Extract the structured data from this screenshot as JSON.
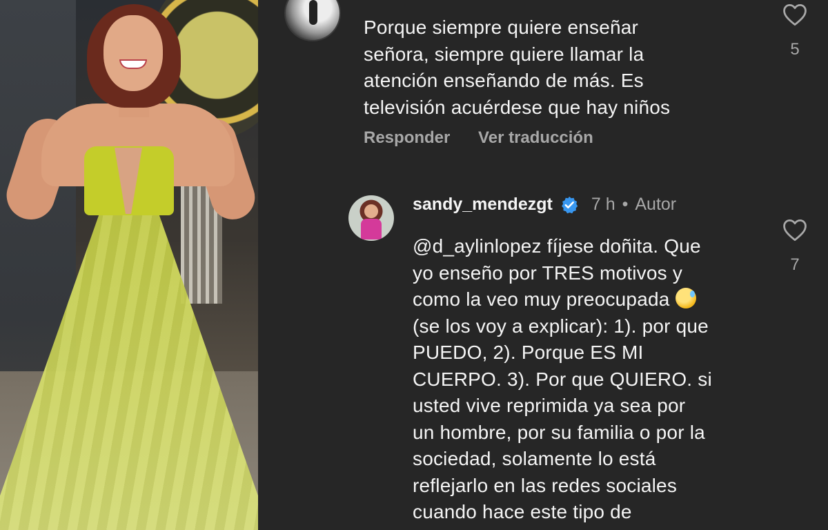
{
  "comment_1": {
    "lines": [
      "Porque siempre quiere enseñar",
      "señora, siempre quiere llamar la",
      "atención enseñando de más. Es",
      "televisión acuérdese que hay niños"
    ],
    "reply_label": "Responder",
    "translate_label": "Ver traducción",
    "like_count": "5"
  },
  "comment_2": {
    "username": "sandy_mendezgt",
    "time": "7 h",
    "dot": "•",
    "author_label": "Autor",
    "lines": [
      "@d_aylinlopez fíjese doñita. Que",
      "yo enseño por TRES motivos y",
      "como la veo muy preocupada",
      "(se los voy a explicar): 1). por que",
      "PUEDO, 2). Porque ES MI",
      "CUERPO. 3). Por que QUIERO. si",
      "usted vive reprimida ya sea por",
      "un hombre, por su familia o por la",
      "sociedad, solamente  lo está",
      "reflejarlo en las redes sociales",
      "cuando hace este tipo de"
    ],
    "like_count": "7"
  },
  "icons": {
    "like": "heart-outline-icon",
    "verified": "verified-badge-icon",
    "emoji": "grinning-sweat-emoji"
  },
  "colors": {
    "background": "#262626",
    "text": "#f5f5f5",
    "secondary_text": "#a8a8a8",
    "verified_blue": "#3897f0"
  }
}
